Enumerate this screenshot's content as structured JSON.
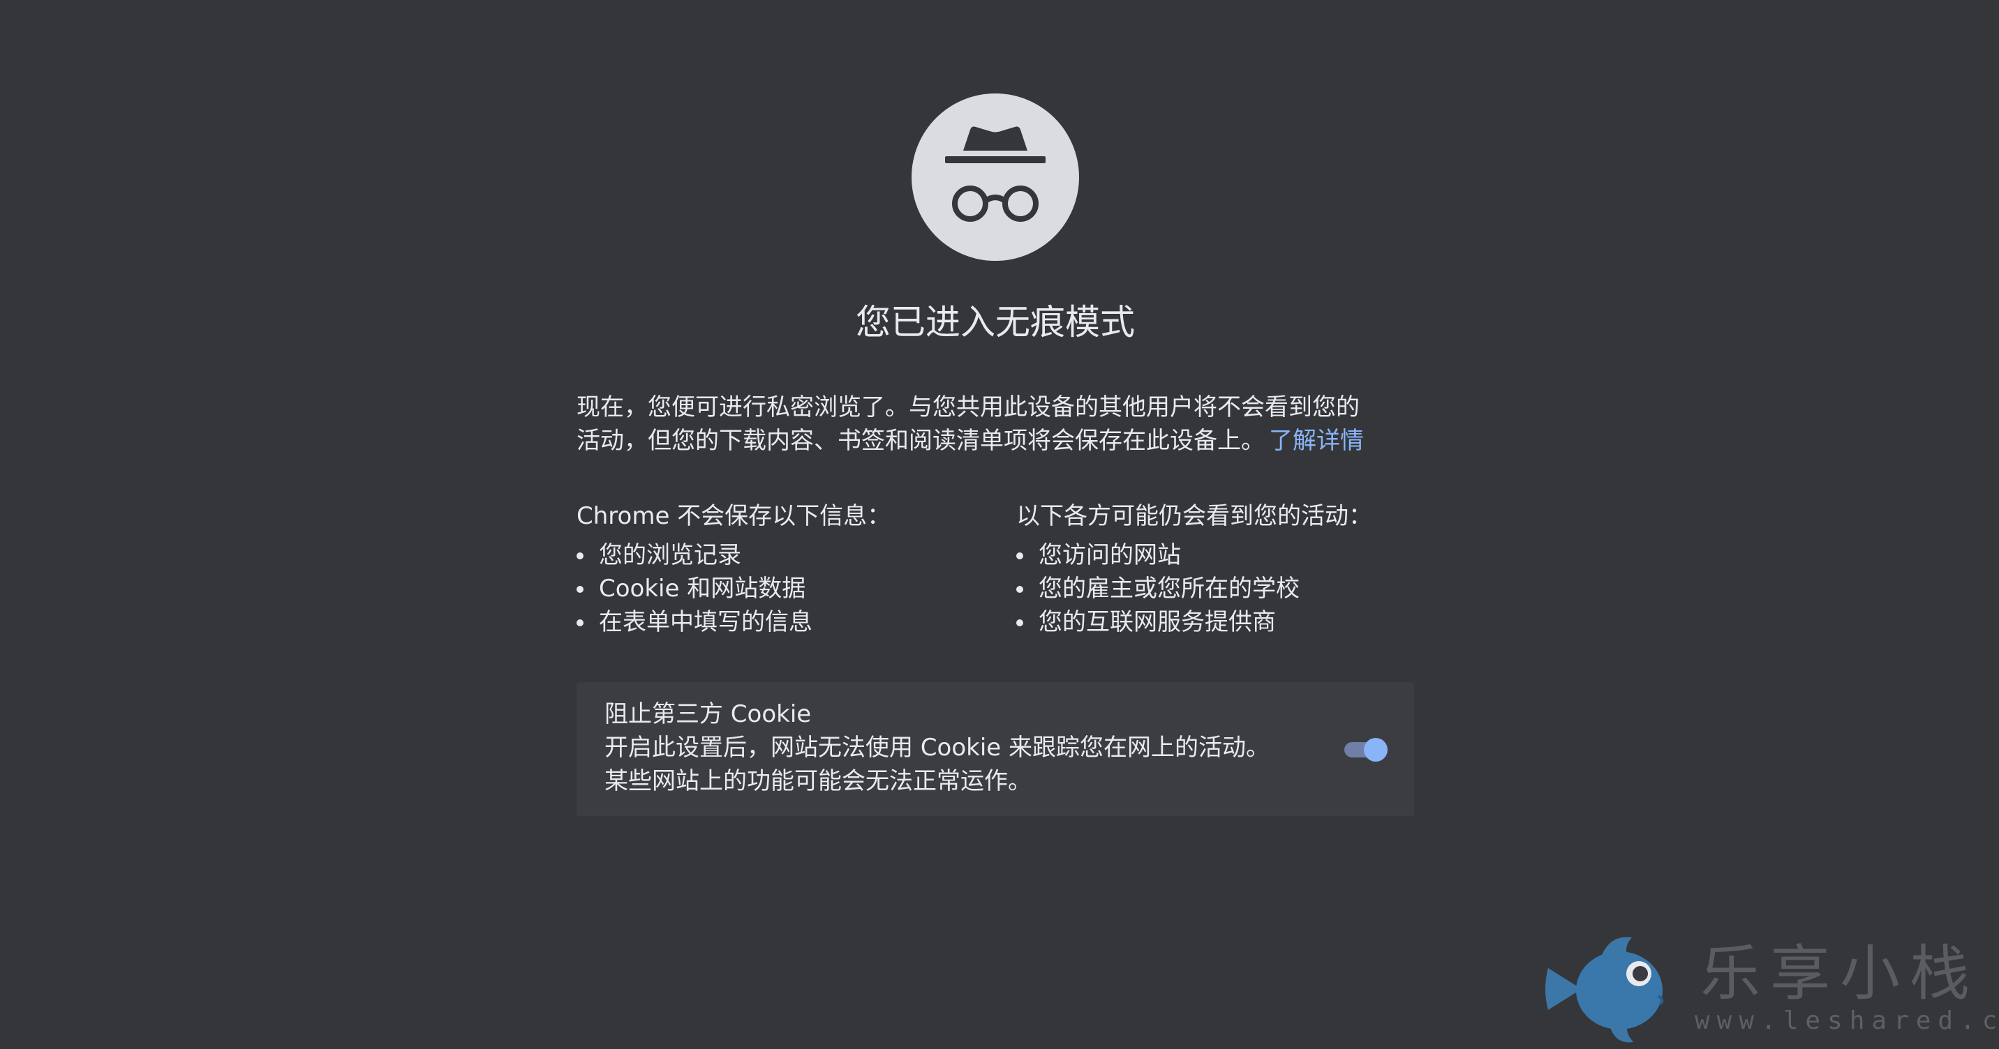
{
  "title": "您已进入无痕模式",
  "intro": {
    "line1": "现在，您便可进行私密浏览了。与您共用此设备的其他用户将不会看到您的",
    "line2": "活动，但您的下载内容、书签和阅读清单项将会保存在此设备上。",
    "learn_more": "了解详情"
  },
  "left_column": {
    "heading": "Chrome 不会保存以下信息：",
    "items": [
      "您的浏览记录",
      "Cookie 和网站数据",
      "在表单中填写的信息"
    ]
  },
  "right_column": {
    "heading": "以下各方可能仍会看到您的活动：",
    "items": [
      "您访问的网站",
      "您的雇主或您所在的学校",
      "您的互联网服务提供商"
    ]
  },
  "cookie_card": {
    "title": "阻止第三方 Cookie",
    "line1": "开启此设置后，网站无法使用 Cookie 来跟踪您在网上的活动。",
    "line2": "某些网站上的功能可能会无法正常运作。",
    "toggle_on": true
  },
  "watermark": {
    "text": "乐享小栈",
    "url": "www.leshared.com"
  },
  "colors": {
    "background": "#35363a",
    "card": "#3c3d41",
    "text": "#e8eaed",
    "link": "#8ab4f8",
    "icon_circle": "#dadce0"
  },
  "icons": {
    "incognito": "incognito-icon",
    "watermark_logo": "fish-logo-icon"
  }
}
